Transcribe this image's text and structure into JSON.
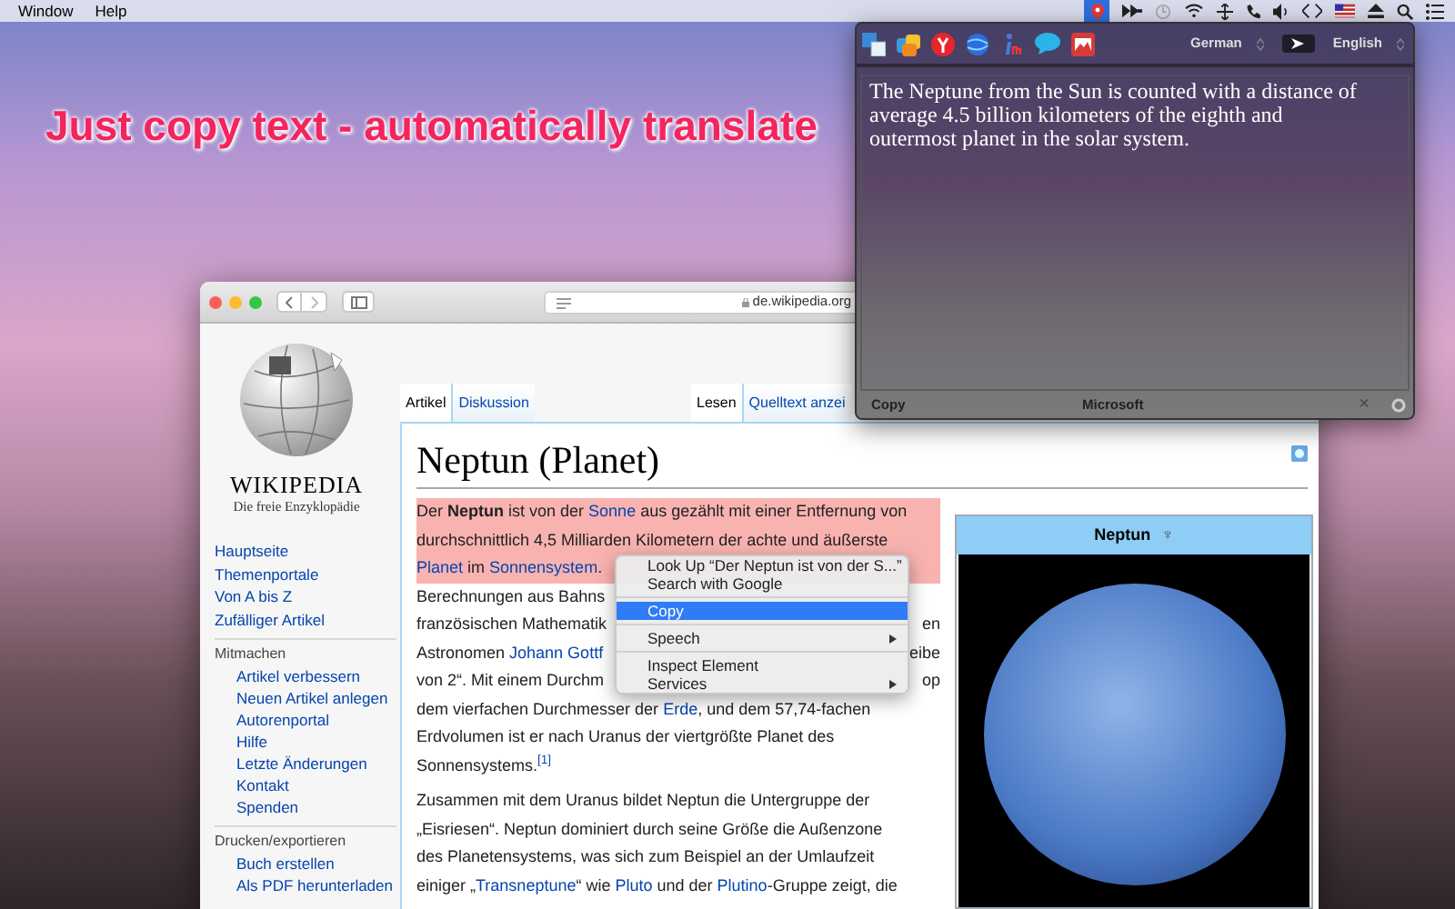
{
  "menu_bar": {
    "items": [
      "Window",
      "Help"
    ]
  },
  "headline": "Just copy text - automatically translate",
  "browser": {
    "address": "de.wikipedia.org",
    "sidebar": {
      "wordmark": "WIKIPEDIA",
      "tagline": "Die freie Enzyklopädie",
      "nav": [
        "Hauptseite",
        "Themenportale",
        "Von A bis Z",
        "Zufälliger Artikel"
      ],
      "sections": [
        {
          "title": "Mitmachen",
          "items": [
            "Artikel verbessern",
            "Neuen Artikel anlegen",
            "Autorenportal",
            "Hilfe",
            "Letzte Änderungen",
            "Kontakt",
            "Spenden"
          ]
        },
        {
          "title": "Drucken/exportieren",
          "items": [
            "Buch erstellen",
            "Als PDF herunterladen"
          ]
        }
      ]
    },
    "tabs_left": [
      {
        "label": "Artikel",
        "selected": true
      },
      {
        "label": "Diskussion",
        "selected": false
      }
    ],
    "tabs_right": [
      {
        "label": "Lesen",
        "selected": true
      },
      {
        "label": "Quelltext anzei",
        "selected": false
      }
    ],
    "title": "Neptun (Planet)",
    "paragraphs": [
      [
        {
          "highlighted": true,
          "segments": [
            {
              "text": "Der **Neptun** ist von der ",
              "link": false
            },
            {
              "text": "Sonne",
              "link": true
            },
            {
              "text": " aus gezählt mit einer Entfernung von",
              "link": false
            }
          ]
        },
        {
          "highlighted": true,
          "segments": [
            {
              "text": "durchschnittlich 4,5 Milliarden Kilometern der achte und äußerste",
              "link": false
            }
          ]
        },
        {
          "highlighted": true,
          "segments": [
            {
              "text": "Planet",
              "link": true
            },
            {
              "text": " im ",
              "link": false
            },
            {
              "text": "Sonnensystem",
              "link": true
            },
            {
              "text": ".",
              "link": false
            }
          ]
        },
        {
          "highlighted": false,
          "segments": [
            {
              "text": "Berechnungen aus Bahns",
              "link": false
            }
          ]
        },
        {
          "highlighted": false,
          "segments": [
            {
              "text": "französischen Mathematik",
              "link": false
            }
          ],
          "right_segments": [
            {
              "text": "en",
              "link": false
            }
          ]
        },
        {
          "highlighted": false,
          "segments": [
            {
              "text": "Astronomen ",
              "link": false
            },
            {
              "text": "Johann Gottf",
              "link": true
            }
          ],
          "right_segments": [
            {
              "text": "eibe",
              "link": false
            }
          ]
        },
        {
          "highlighted": false,
          "segments": [
            {
              "text": "von 2“. Mit einem Durchm",
              "link": false
            }
          ],
          "right_segments": [
            {
              "text": "op",
              "link": false
            }
          ]
        },
        {
          "highlighted": false,
          "segments": [
            {
              "text": "dem vierfachen Durchmesser der ",
              "link": false
            },
            {
              "text": "Erde",
              "link": true
            },
            {
              "text": ", und dem 57,74-fachen",
              "link": false
            }
          ]
        },
        {
          "highlighted": false,
          "segments": [
            {
              "text": "Erdvolumen ist er nach Uranus der viertgrößte Planet des",
              "link": false
            }
          ]
        },
        {
          "highlighted": false,
          "segments": [
            {
              "text": "Sonnensystems.",
              "link": false
            },
            {
              "text": "$^{[1]}$",
              "link": true
            }
          ]
        }
      ],
      [
        {
          "highlighted": false,
          "segments": [
            {
              "text": "Zusammen mit dem Uranus bildet Neptun die Untergruppe der",
              "link": false
            }
          ]
        },
        {
          "highlighted": false,
          "segments": [
            {
              "text": "„Eisriesen“. Neptun dominiert durch seine Größe die Außenzone",
              "link": false
            }
          ]
        },
        {
          "highlighted": false,
          "segments": [
            {
              "text": "des Planetensystems, was sich zum Beispiel an der Umlaufzeit",
              "link": false
            }
          ]
        },
        {
          "highlighted": false,
          "segments": [
            {
              "text": "einiger „",
              "link": false
            },
            {
              "text": "Transneptune",
              "link": true
            },
            {
              "text": "“ wie ",
              "link": false
            },
            {
              "text": "Pluto",
              "link": true
            },
            {
              "text": " und der ",
              "link": false
            },
            {
              "text": "Plutino",
              "link": true
            },
            {
              "text": "-Gruppe zeigt, die",
              "link": false
            }
          ]
        }
      ]
    ],
    "infobox": {
      "title": "Neptun",
      "symbol": "♆"
    }
  },
  "context_menu": {
    "items": [
      {
        "kind": "item",
        "label": "Look Up “Der Neptun ist von der S...”",
        "selected": false,
        "submenu": false
      },
      {
        "kind": "item",
        "label": "Search with Google",
        "selected": false,
        "submenu": false
      },
      {
        "kind": "separator"
      },
      {
        "kind": "item",
        "label": "Copy",
        "selected": true,
        "submenu": false
      },
      {
        "kind": "separator"
      },
      {
        "kind": "item",
        "label": "Speech",
        "selected": false,
        "submenu": true
      },
      {
        "kind": "separator"
      },
      {
        "kind": "item",
        "label": "Inspect Element",
        "selected": false,
        "submenu": false
      },
      {
        "kind": "item",
        "label": "Services",
        "selected": false,
        "submenu": true
      }
    ]
  },
  "translator": {
    "source_language": "German",
    "target_language": "English",
    "text": "The Neptune from the Sun is counted with a distance of average 4.5 billion kilometers of the eighth and outermost planet in the solar system.",
    "footer": {
      "copy": "Copy",
      "engine": "Microsoft",
      "close": "×"
    }
  }
}
